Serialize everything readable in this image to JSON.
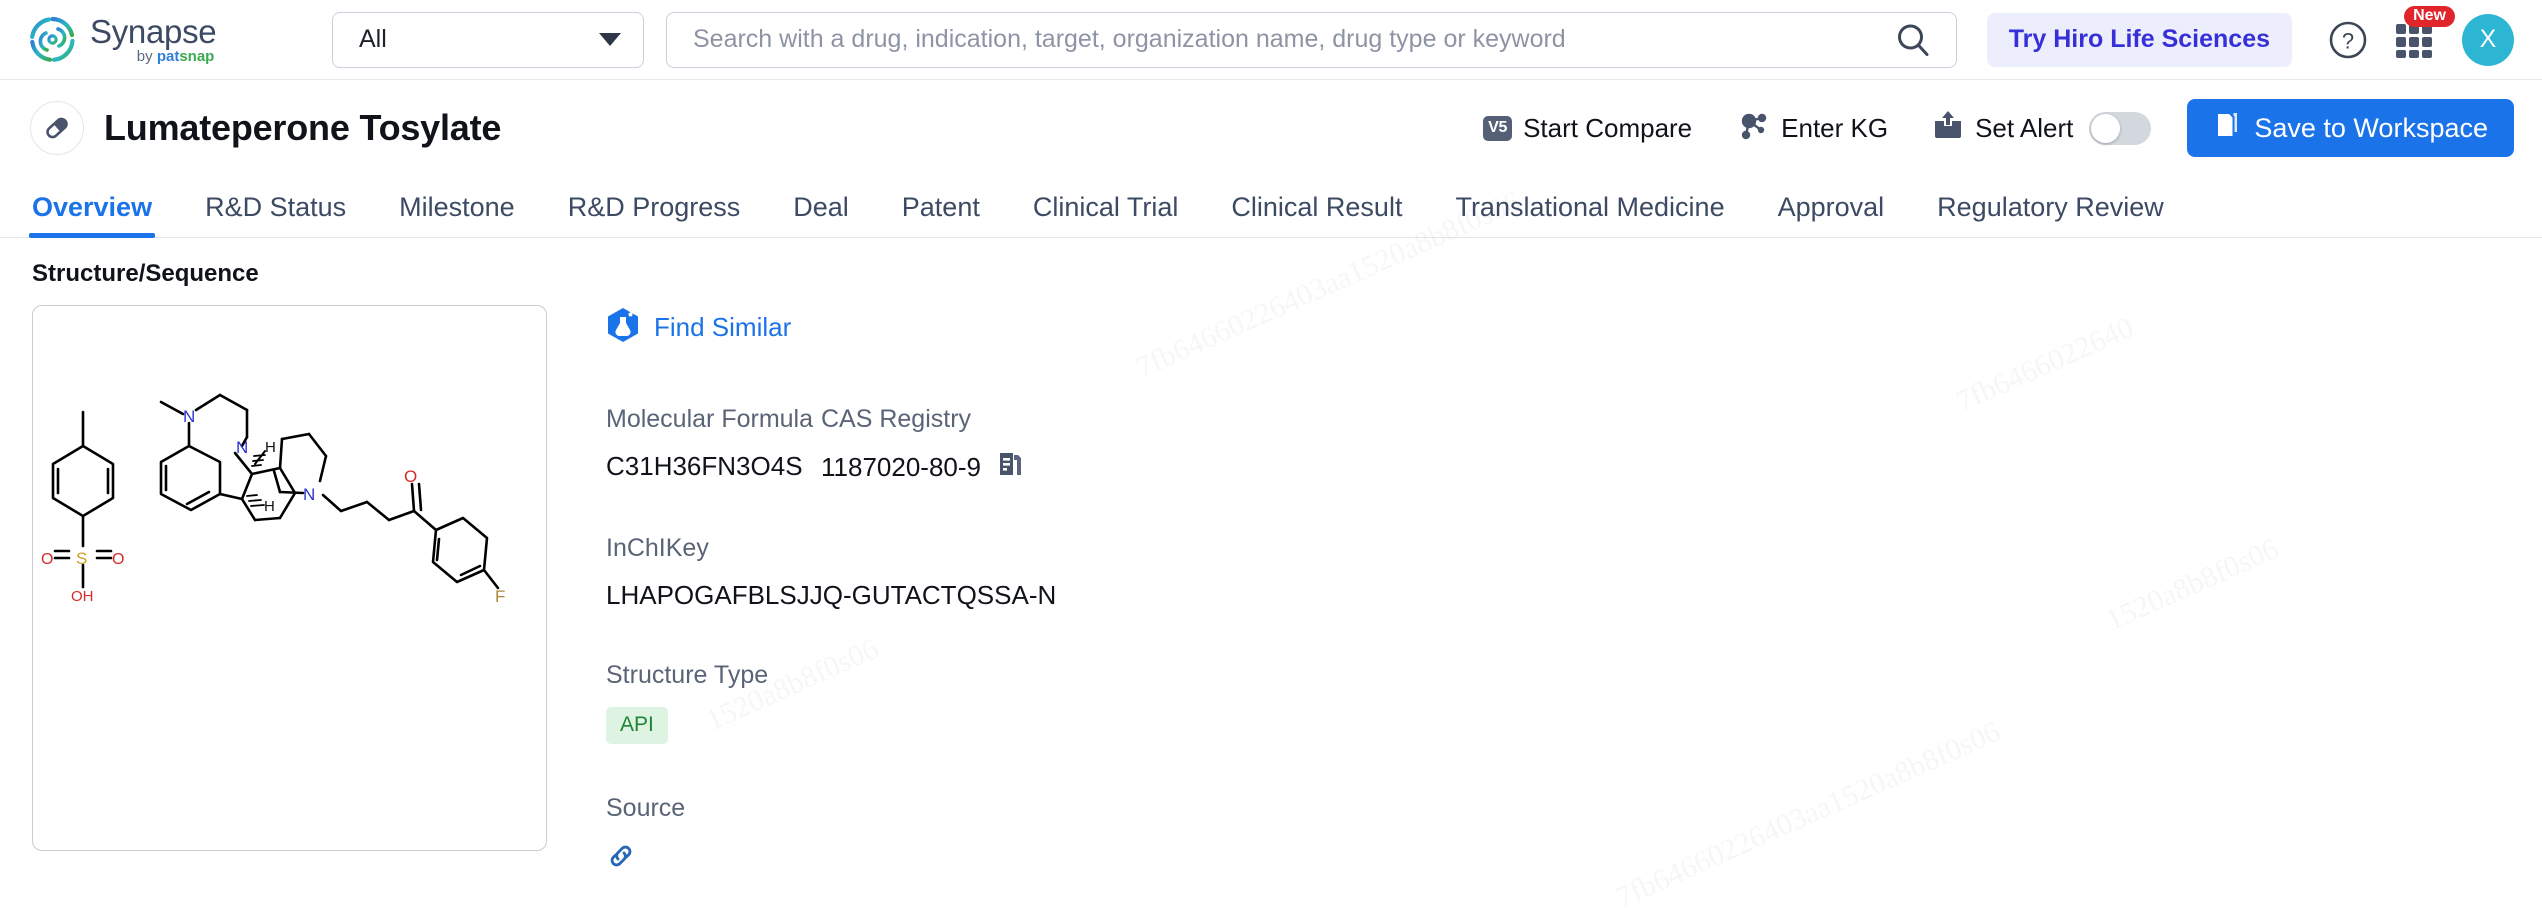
{
  "topbar": {
    "brand_name": "Synapse",
    "brand_by": "by ",
    "brand_pat": "pat",
    "brand_snap": "snap",
    "scope_selected": "All",
    "scope_icon": "chevron-down-icon",
    "search_value": "",
    "search_placeholder": "Search with a drug, indication, target, organization name, drug type or keyword",
    "search_icon": "search-icon",
    "try_hiro_label": "Try Hiro Life Sciences",
    "help_icon": "question-circle-icon",
    "apps_icon": "grid-apps-icon",
    "apps_badge": "New",
    "avatar_initial": "X",
    "accent_blue": "#1a73e8",
    "hiro_purple": "#3730d8",
    "badge_red": "#e0252b",
    "avatar_teal": "#2cb6d4"
  },
  "drug_header": {
    "icon": "pill-capsule-icon",
    "title": "Lumateperone Tosylate",
    "actions": [
      {
        "label": "Start Compare",
        "icon": "v5-badge-icon",
        "badge_text": "V5"
      },
      {
        "label": "Enter KG",
        "icon": "knowledge-graph-icon"
      },
      {
        "label": "Set Alert",
        "icon": "alert-inbox-icon"
      }
    ],
    "alert_toggle_state": "off",
    "save_label": "Save to Workspace",
    "save_icon": "folder-icon"
  },
  "tabs": {
    "active": "Overview",
    "items": [
      "Overview",
      "R&D Status",
      "Milestone",
      "R&D Progress",
      "Deal",
      "Patent",
      "Clinical Trial",
      "Clinical Result",
      "Translational Medicine",
      "Approval",
      "Regulatory Review"
    ]
  },
  "main": {
    "section_title": "Structure/Sequence",
    "find_similar_label": "Find Similar",
    "find_similar_icon": "flask-hexagon-icon",
    "fields": {
      "molecular_formula_label": "Molecular Formula",
      "molecular_formula_value": "C31H36FN3O4S",
      "cas_registry_label": "CAS Registry",
      "cas_registry_value": "1187020-80-9",
      "cas_copy_icon": "copy-icon",
      "inchikey_label": "InChIKey",
      "inchikey_value": "LHAPOGAFBLSJJQ-GUTACTQSSA-N",
      "structure_type_label": "Structure Type",
      "structure_type_value": "API",
      "structure_type_color": "#1e8438",
      "source_label": "Source",
      "source_icon": "link-icon"
    },
    "structure_atoms": {
      "nitrogen": "N",
      "oxygen": "O",
      "sulfur": "S",
      "fluorine": "F",
      "hydrogen": "H",
      "hydroxyl": "OH",
      "nitrogen_color": "#2b35d0",
      "oxygen_color": "#d42b2b",
      "sulfur_color": "#c9a227",
      "fluorine_color": "#b08838",
      "bond_color": "#000000"
    }
  },
  "watermarks": [
    "7fb64660226403aa1520a8b8f0s06",
    "7fb6466022640",
    "1520a8b8f0s06"
  ]
}
